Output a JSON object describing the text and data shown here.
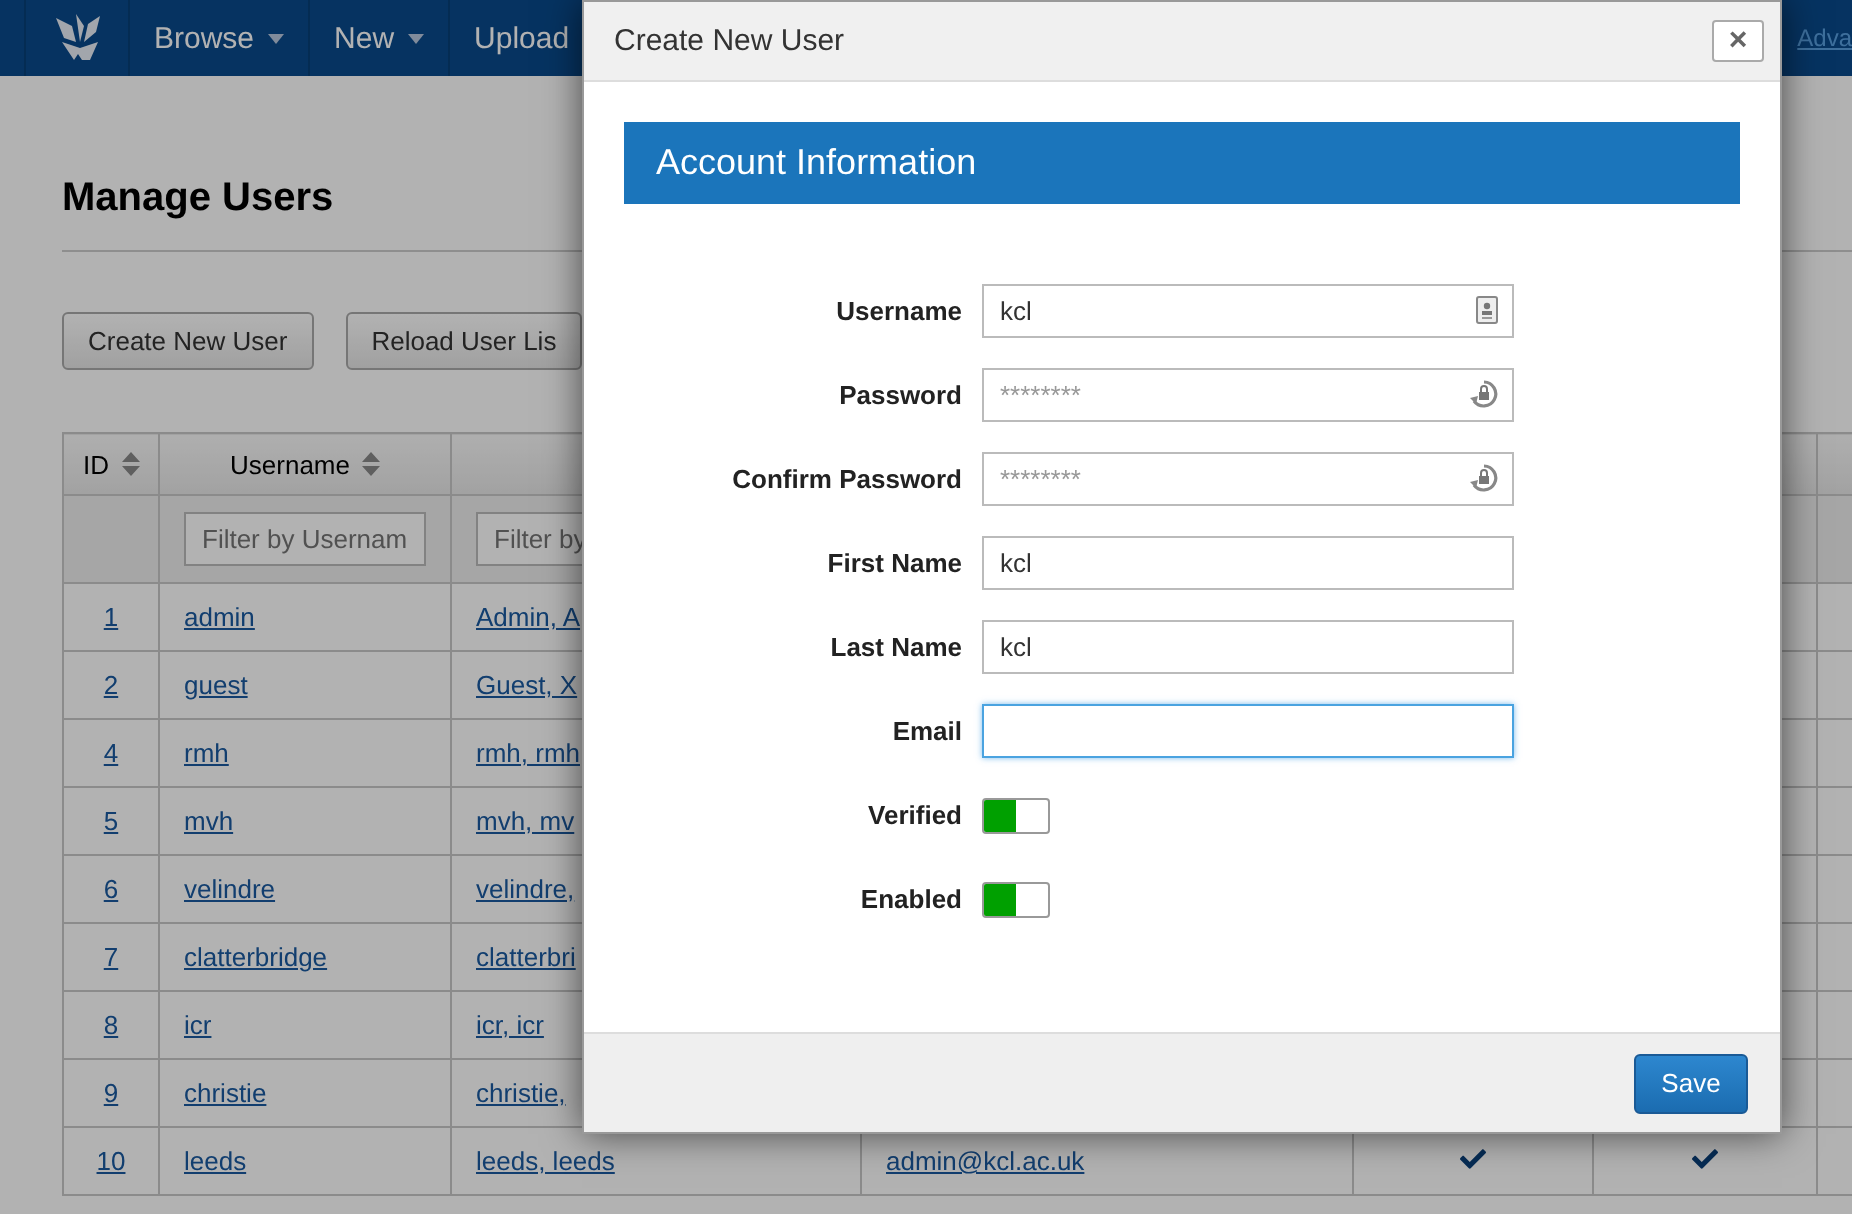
{
  "navbar": {
    "items": [
      {
        "label": "Browse",
        "dropdown": true
      },
      {
        "label": "New",
        "dropdown": true
      },
      {
        "label": "Upload"
      }
    ],
    "right_link": "Adva"
  },
  "page": {
    "title": "Manage Users",
    "buttons": [
      "Create New User",
      "Reload User Lis"
    ]
  },
  "table": {
    "columns": [
      {
        "label": "ID",
        "sortable": true
      },
      {
        "label": "Username",
        "sortable": true
      }
    ],
    "filters": [
      {
        "placeholder": "Filter by Usernam"
      },
      {
        "placeholder": "Filter by"
      }
    ],
    "rows": [
      {
        "id": "1",
        "username": "admin",
        "name": "Admin, A"
      },
      {
        "id": "2",
        "username": "guest",
        "name": "Guest, X"
      },
      {
        "id": "4",
        "username": "rmh",
        "name": "rmh, rmh"
      },
      {
        "id": "5",
        "username": "mvh",
        "name": "mvh, mv"
      },
      {
        "id": "6",
        "username": "velindre",
        "name": "velindre,"
      },
      {
        "id": "7",
        "username": "clatterbridge",
        "name": "clatterbri"
      },
      {
        "id": "8",
        "username": "icr",
        "name": "icr, icr"
      },
      {
        "id": "9",
        "username": "christie",
        "name": "christie,"
      },
      {
        "id": "10",
        "username": "leeds",
        "name": "leeds, leeds",
        "email": "admin@kcl.ac.uk",
        "verified": true,
        "enabled": true
      }
    ]
  },
  "dialog": {
    "title": "Create New User",
    "close": "×",
    "section": "Account Information",
    "fields": [
      {
        "label": "Username",
        "kind": "account",
        "value": "kcl",
        "focused": false
      },
      {
        "label": "Password",
        "kind": "password",
        "placeholder": "********",
        "focused": false
      },
      {
        "label": "Confirm Password",
        "kind": "password",
        "placeholder": "********",
        "focused": false
      },
      {
        "label": "First Name",
        "kind": "text",
        "value": "kcl",
        "focused": false
      },
      {
        "label": "Last Name",
        "kind": "text",
        "value": "kcl",
        "focused": false
      },
      {
        "label": "Email",
        "kind": "text",
        "focused": true
      },
      {
        "label": "Verified",
        "kind": "toggle",
        "on": true
      },
      {
        "label": "Enabled",
        "kind": "toggle",
        "on": true
      }
    ],
    "save": "Save"
  }
}
